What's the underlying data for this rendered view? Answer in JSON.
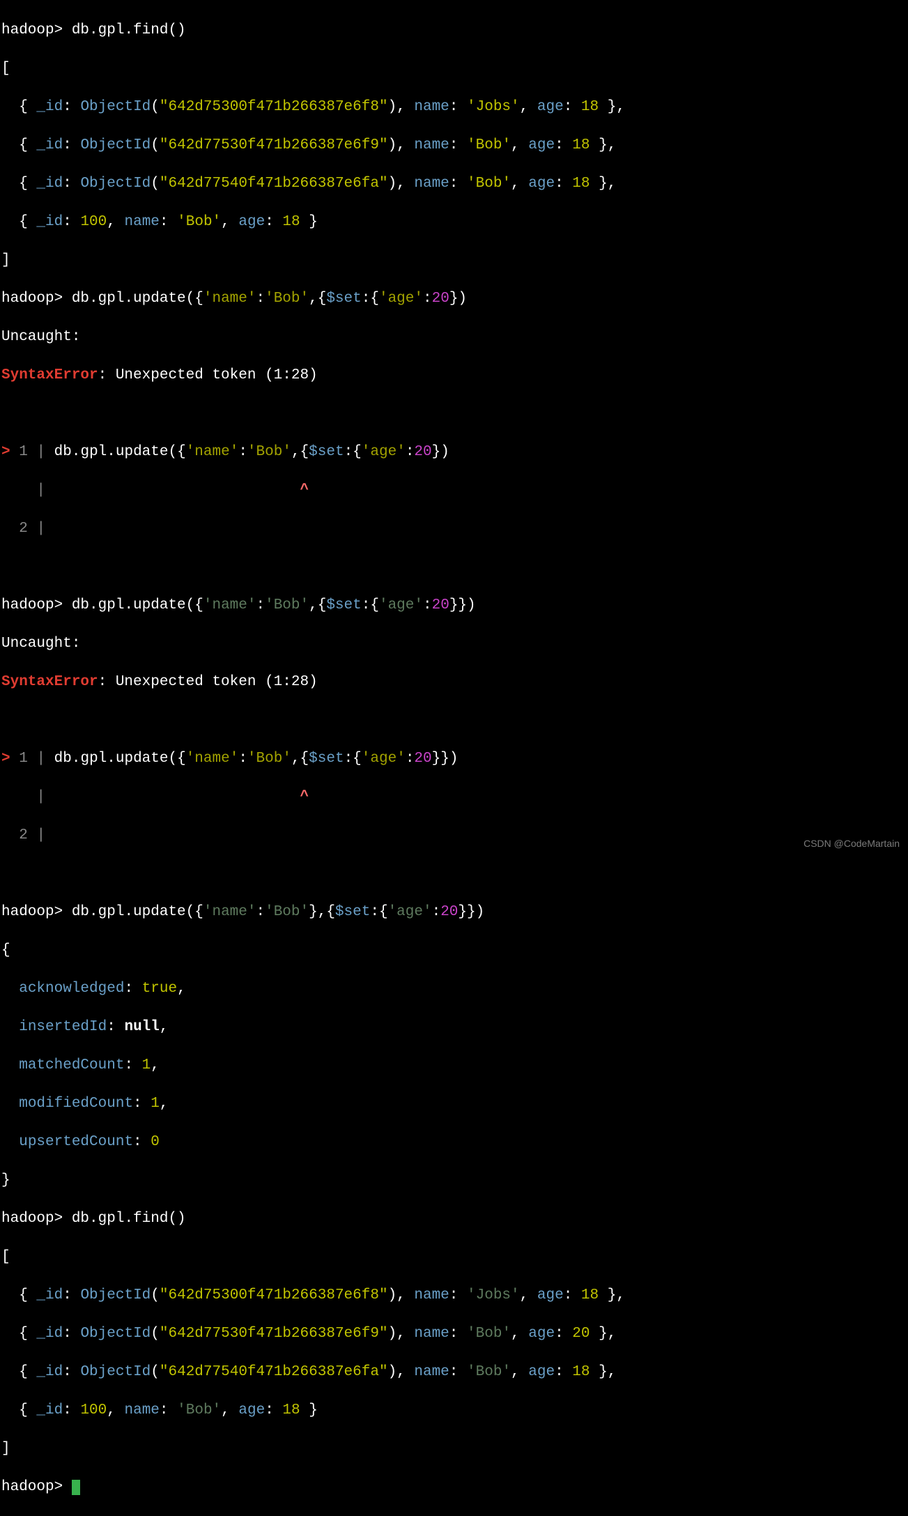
{
  "prompt": "hadoop>",
  "cmd_find": "db.gpl.find()",
  "cmd_update_err1": "db.gpl.update({'name':'Bob',{$set:{'age':20})",
  "cmd_update_err2": "db.gpl.update({'name':'Bob',{$set:{'age':20}})",
  "cmd_update_ok": "db.gpl.update({'name':'Bob'},{$set:{'age':20}})",
  "uncaught": "Uncaught:",
  "syntax_error": "SyntaxError",
  "syntax_msg": ": Unexpected token (1:28)",
  "gutter_gt": ">",
  "gutter_1": "1",
  "gutter_2": "2",
  "pipe": "|",
  "caret": "^",
  "objid_label": "ObjectId",
  "docs1": [
    {
      "id": "642d75300f471b266387e6f8",
      "name": "Jobs",
      "age": 18
    },
    {
      "id": "642d77530f471b266387e6f9",
      "name": "Bob",
      "age": 18
    },
    {
      "id": "642d77540f471b266387e6fa",
      "name": "Bob",
      "age": 18
    }
  ],
  "doc1_simple": {
    "id": 100,
    "name": "Bob",
    "age": 18
  },
  "update_result": {
    "acknowledged": "true",
    "insertedId": "null",
    "matchedCount": 1,
    "modifiedCount": 1,
    "upsertedCount": 0
  },
  "docs2": [
    {
      "id": "642d75300f471b266387e6f8",
      "name": "Jobs",
      "age": 18
    },
    {
      "id": "642d77530f471b266387e6f9",
      "name": "Bob",
      "age": 20
    },
    {
      "id": "642d77540f471b266387e6fa",
      "name": "Bob",
      "age": 18
    }
  ],
  "doc2_simple": {
    "id": 100,
    "name": "Bob",
    "age": 18
  },
  "watermark": "CSDN @CodeMartain",
  "labels": {
    "id": "_id",
    "name": "name",
    "age": "age"
  },
  "update_parts": {
    "pre": "db.gpl.update({",
    "name_key": "'name'",
    "name_val": "'Bob'",
    "set": "$set",
    "age_key": "'age'",
    "age_val": "20"
  }
}
